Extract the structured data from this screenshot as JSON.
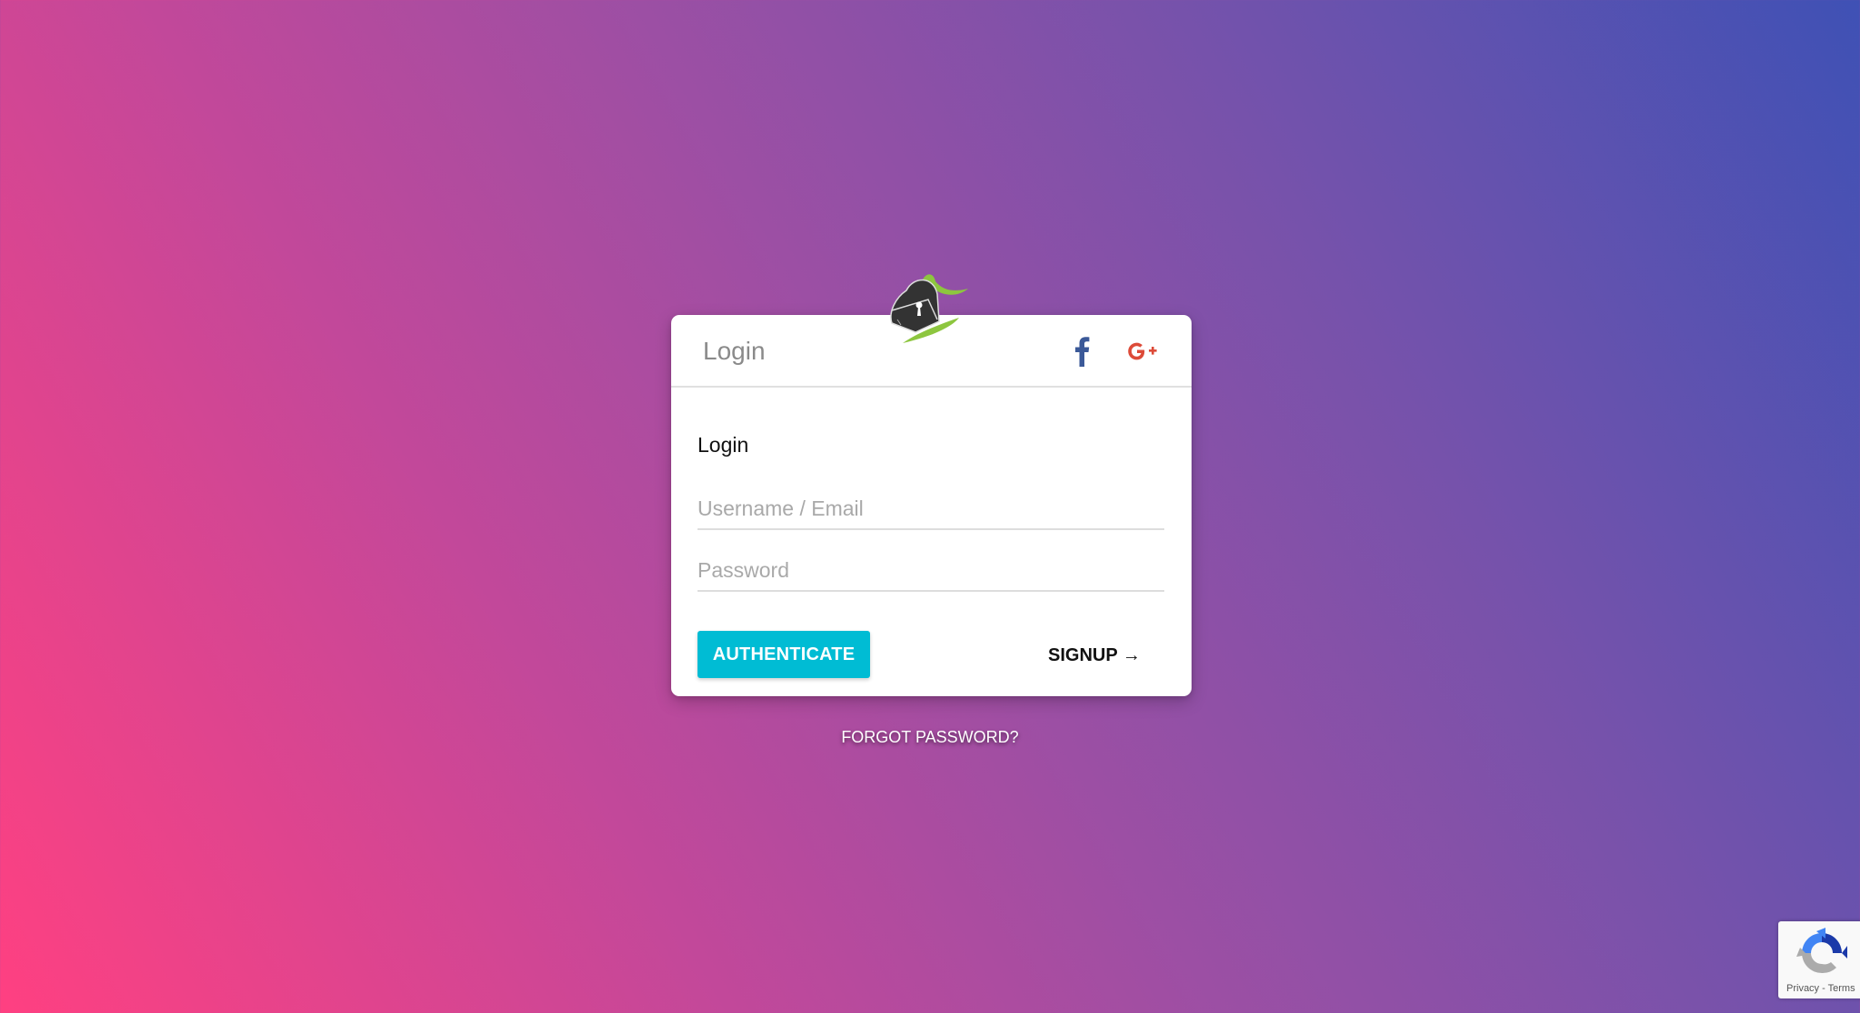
{
  "logo": {
    "icon": "knight-helmet-logo",
    "accent_color": "#8dc63f",
    "body_color": "#333333"
  },
  "card": {
    "header_title": "Login",
    "social": [
      {
        "name": "facebook",
        "icon": "facebook-icon",
        "glyph": "f",
        "color": "#3b5998"
      },
      {
        "name": "google-plus",
        "icon": "google-plus-icon",
        "glyph": "G+",
        "color": "#dd4b39"
      }
    ],
    "form_label": "Login",
    "username": {
      "value": "",
      "placeholder": "Username / Email"
    },
    "password": {
      "value": "",
      "placeholder": "Password"
    },
    "authenticate_label": "AUTHENTICATE",
    "signup_label": "SIGNUP →"
  },
  "forgot_password_label": "FORGOT PASSWORD?",
  "recaptcha": {
    "privacy_label": "Privacy",
    "separator": " - ",
    "terms_label": "Terms"
  },
  "colors": {
    "gradient_start": "#ff4081",
    "gradient_end": "#3f51b5",
    "primary_button": "#00bcd4"
  }
}
